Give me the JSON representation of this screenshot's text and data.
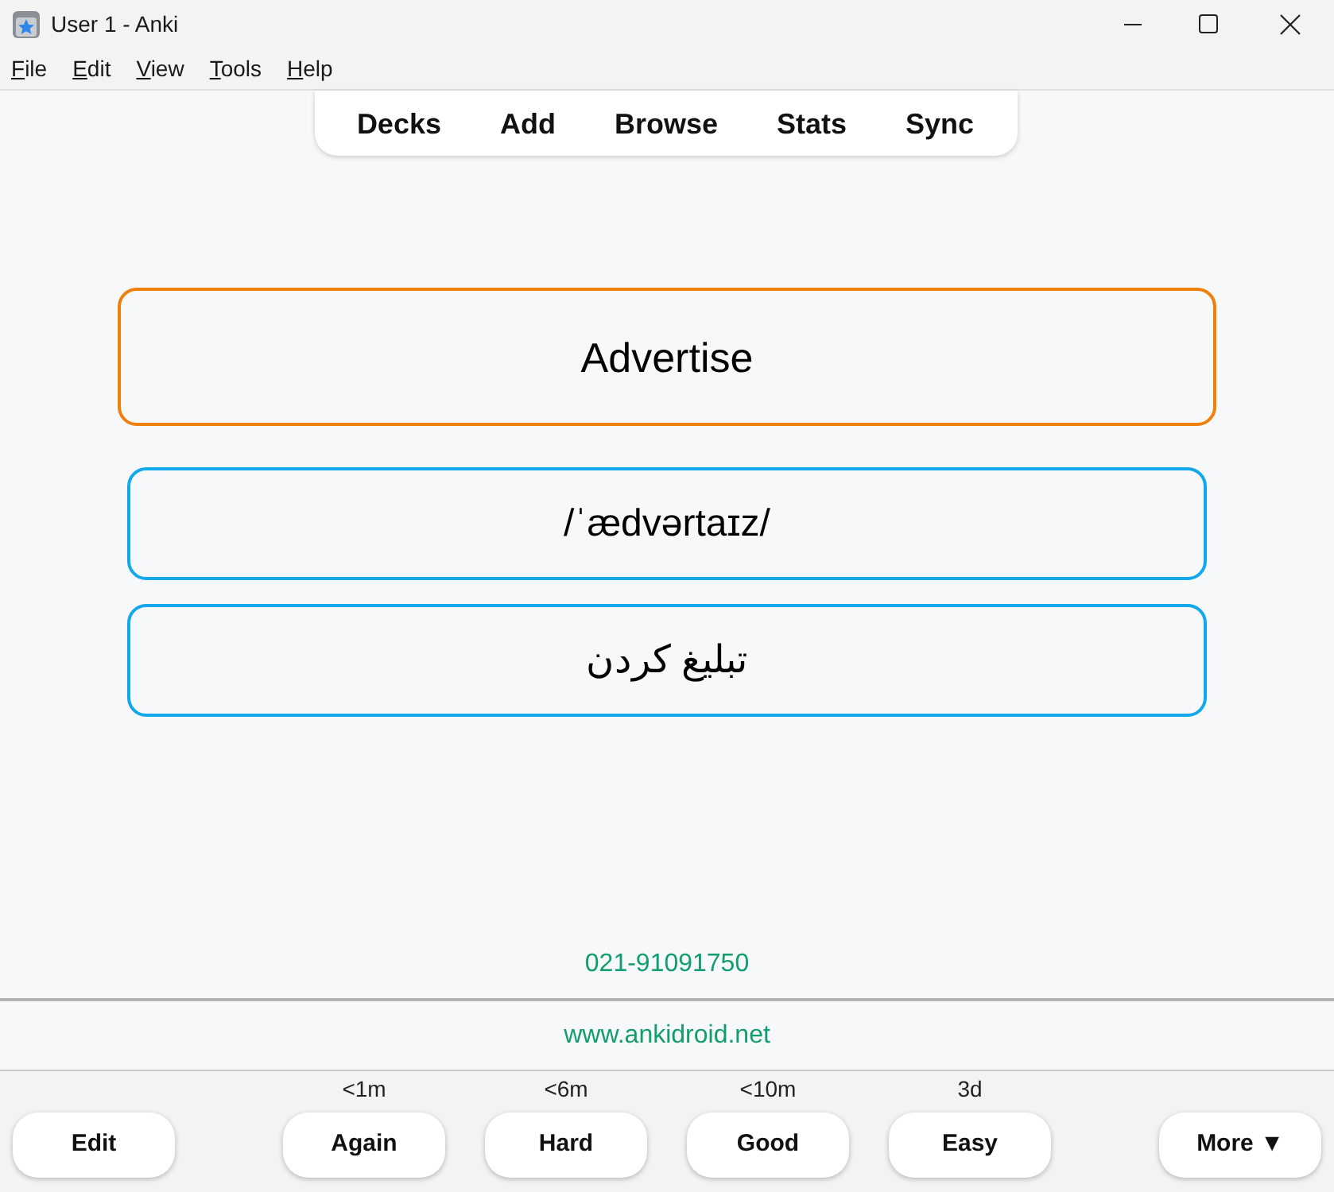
{
  "window": {
    "title": "User 1 - Anki"
  },
  "menu": [
    "File",
    "Edit",
    "View",
    "Tools",
    "Help"
  ],
  "toolbar": [
    "Decks",
    "Add",
    "Browse",
    "Stats",
    "Sync"
  ],
  "card": {
    "fields": [
      {
        "kind": "question",
        "text": "Advertise"
      },
      {
        "kind": "answer",
        "text": "/ˈædvərtaɪz/"
      },
      {
        "kind": "answer",
        "text": "تبلیغ کردن"
      }
    ],
    "phone": "021-91091750"
  },
  "footer": {
    "website": "www.ankidroid.net"
  },
  "bottom_bar": {
    "edit": "Edit",
    "answers": [
      {
        "interval": "<1m",
        "label": "Again"
      },
      {
        "interval": "<6m",
        "label": "Hard"
      },
      {
        "interval": "<10m",
        "label": "Good"
      },
      {
        "interval": "3d",
        "label": "Easy"
      }
    ],
    "more": "More ▼"
  }
}
